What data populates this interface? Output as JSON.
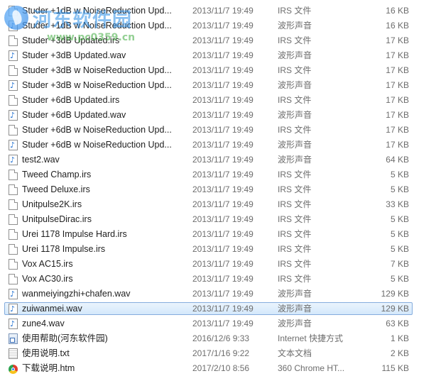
{
  "watermark": {
    "site_name": "河东软件园",
    "url": "www.pc0359.cn"
  },
  "files": [
    {
      "name": "Studer +1dB w NoiseReduction Upd...",
      "date": "2013/11/7 19:49",
      "type": "IRS 文件",
      "size": "16 KB",
      "icon": "irs"
    },
    {
      "name": "Studer +1dB w NoiseReduction Upd...",
      "date": "2013/11/7 19:49",
      "type": "波形声音",
      "size": "16 KB",
      "icon": "wav"
    },
    {
      "name": "Studer +3dB Updated.irs",
      "date": "2013/11/7 19:49",
      "type": "IRS 文件",
      "size": "17 KB",
      "icon": "irs"
    },
    {
      "name": "Studer +3dB Updated.wav",
      "date": "2013/11/7 19:49",
      "type": "波形声音",
      "size": "17 KB",
      "icon": "wav"
    },
    {
      "name": "Studer +3dB w NoiseReduction Upd...",
      "date": "2013/11/7 19:49",
      "type": "IRS 文件",
      "size": "17 KB",
      "icon": "irs"
    },
    {
      "name": "Studer +3dB w NoiseReduction Upd...",
      "date": "2013/11/7 19:49",
      "type": "波形声音",
      "size": "17 KB",
      "icon": "wav"
    },
    {
      "name": "Studer +6dB Updated.irs",
      "date": "2013/11/7 19:49",
      "type": "IRS 文件",
      "size": "17 KB",
      "icon": "irs"
    },
    {
      "name": "Studer +6dB Updated.wav",
      "date": "2013/11/7 19:49",
      "type": "波形声音",
      "size": "17 KB",
      "icon": "wav"
    },
    {
      "name": "Studer +6dB w NoiseReduction Upd...",
      "date": "2013/11/7 19:49",
      "type": "IRS 文件",
      "size": "17 KB",
      "icon": "irs"
    },
    {
      "name": "Studer +6dB w NoiseReduction Upd...",
      "date": "2013/11/7 19:49",
      "type": "波形声音",
      "size": "17 KB",
      "icon": "wav"
    },
    {
      "name": "test2.wav",
      "date": "2013/11/7 19:49",
      "type": "波形声音",
      "size": "64 KB",
      "icon": "wav"
    },
    {
      "name": "Tweed Champ.irs",
      "date": "2013/11/7 19:49",
      "type": "IRS 文件",
      "size": "5 KB",
      "icon": "irs"
    },
    {
      "name": "Tweed Deluxe.irs",
      "date": "2013/11/7 19:49",
      "type": "IRS 文件",
      "size": "5 KB",
      "icon": "irs"
    },
    {
      "name": "Unitpulse2K.irs",
      "date": "2013/11/7 19:49",
      "type": "IRS 文件",
      "size": "33 KB",
      "icon": "irs"
    },
    {
      "name": "UnitpulseDirac.irs",
      "date": "2013/11/7 19:49",
      "type": "IRS 文件",
      "size": "5 KB",
      "icon": "irs"
    },
    {
      "name": "Urei 1178 Impulse Hard.irs",
      "date": "2013/11/7 19:49",
      "type": "IRS 文件",
      "size": "5 KB",
      "icon": "irs"
    },
    {
      "name": "Urei 1178 Impulse.irs",
      "date": "2013/11/7 19:49",
      "type": "IRS 文件",
      "size": "5 KB",
      "icon": "irs"
    },
    {
      "name": "Vox AC15.irs",
      "date": "2013/11/7 19:49",
      "type": "IRS 文件",
      "size": "7 KB",
      "icon": "irs"
    },
    {
      "name": "Vox AC30.irs",
      "date": "2013/11/7 19:49",
      "type": "IRS 文件",
      "size": "5 KB",
      "icon": "irs"
    },
    {
      "name": "wanmeiyingzhi+chafen.wav",
      "date": "2013/11/7 19:49",
      "type": "波形声音",
      "size": "129 KB",
      "icon": "wav"
    },
    {
      "name": "zuiwanmei.wav",
      "date": "2013/11/7 19:49",
      "type": "波形声音",
      "size": "129 KB",
      "icon": "wav",
      "selected": true
    },
    {
      "name": "zune4.wav",
      "date": "2013/11/7 19:49",
      "type": "波形声音",
      "size": "63 KB",
      "icon": "wav"
    },
    {
      "name": "使用帮助(河东软件园)",
      "date": "2016/12/6 9:33",
      "type": "Internet 快捷方式",
      "size": "1 KB",
      "icon": "lnk"
    },
    {
      "name": "使用说明.txt",
      "date": "2017/1/16 9:22",
      "type": "文本文档",
      "size": "2 KB",
      "icon": "txt"
    },
    {
      "name": "下载说明.htm",
      "date": "2017/2/10 8:56",
      "type": "360 Chrome HT...",
      "size": "115 KB",
      "icon": "htm"
    }
  ]
}
